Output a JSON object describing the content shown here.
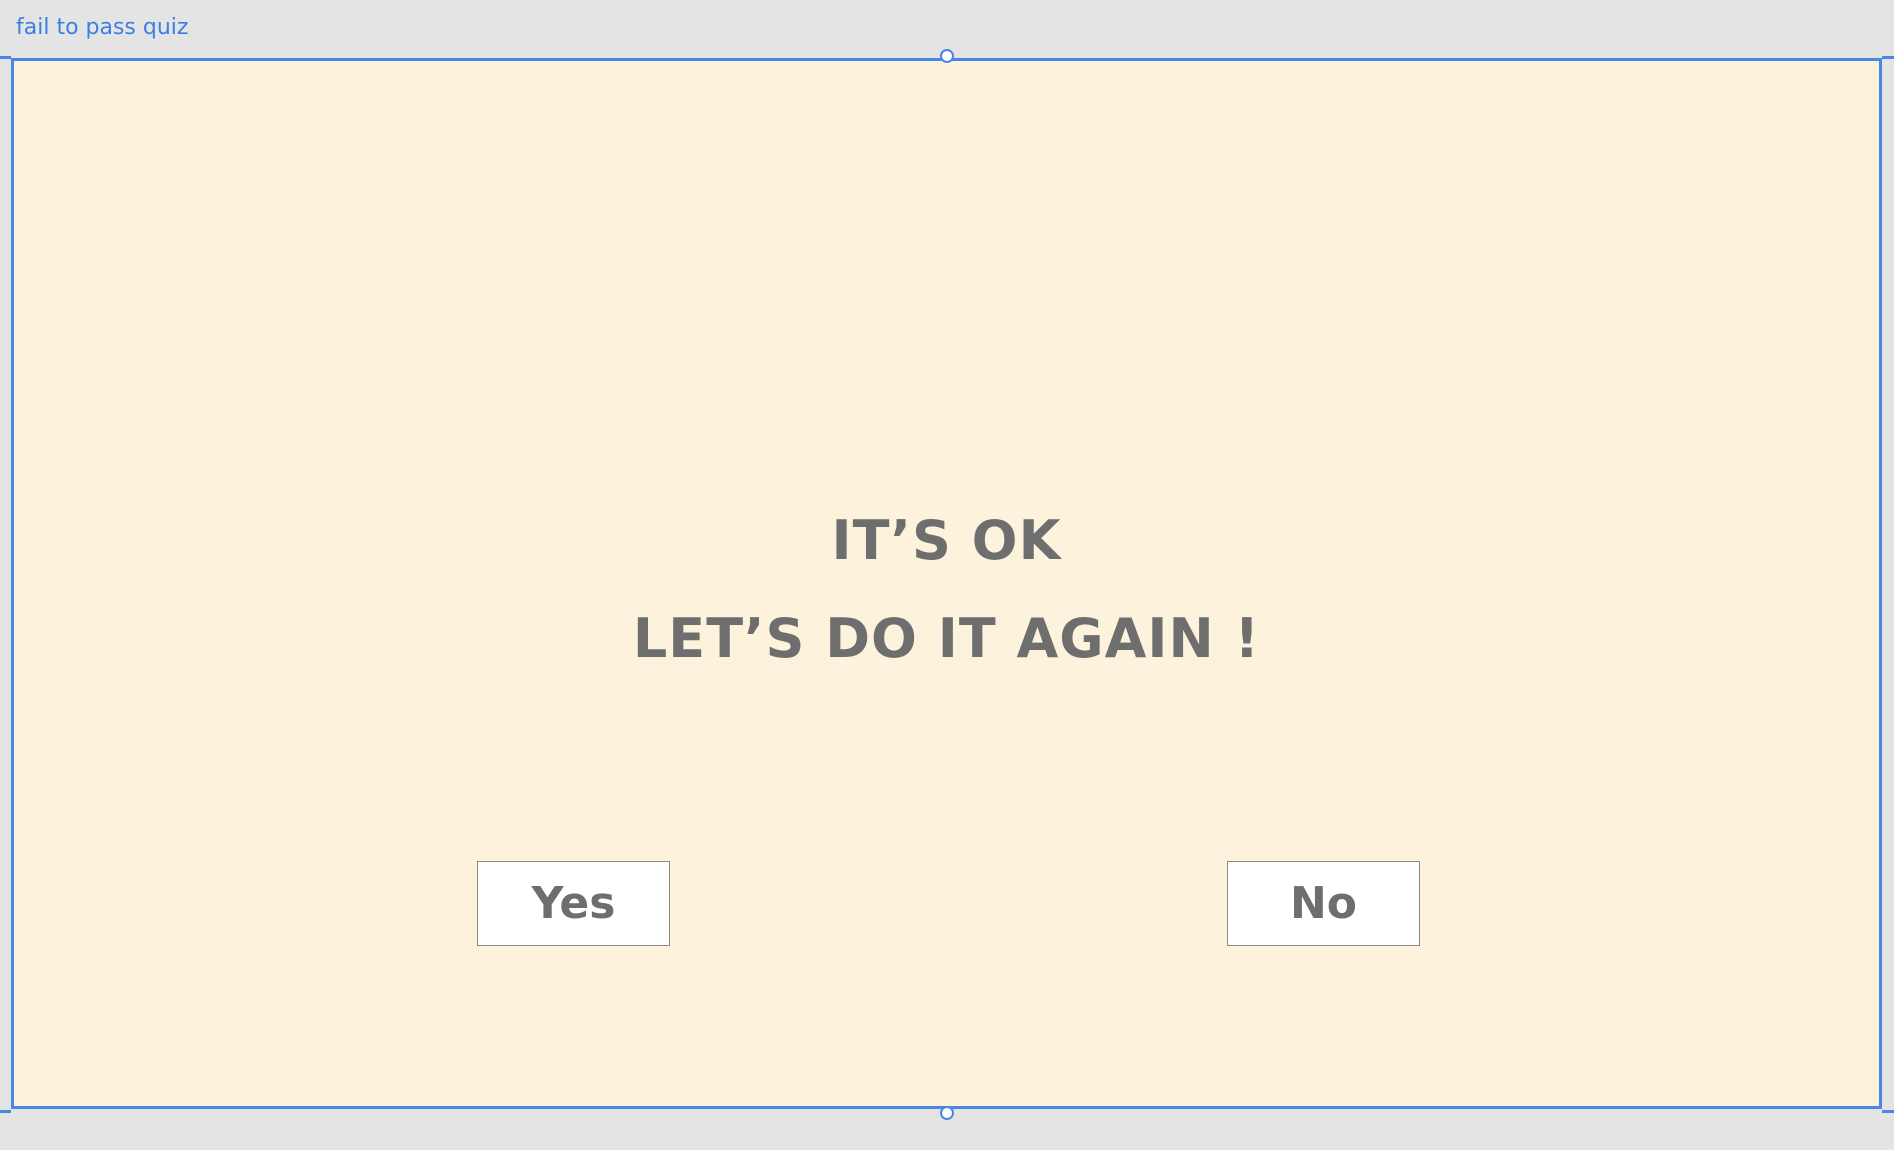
{
  "artboard": {
    "label": "fail to pass quiz"
  },
  "message": {
    "line1": "IT’S OK",
    "line2": "LET’S DO IT AGAIN !"
  },
  "buttons": {
    "yes_label": "Yes",
    "no_label": "No"
  },
  "colors": {
    "selection_accent": "#4a86e8",
    "artboard_background": "#fdf3dd",
    "text_gray": "#6e6e6e",
    "canvas_background": "#e4e4e5"
  }
}
